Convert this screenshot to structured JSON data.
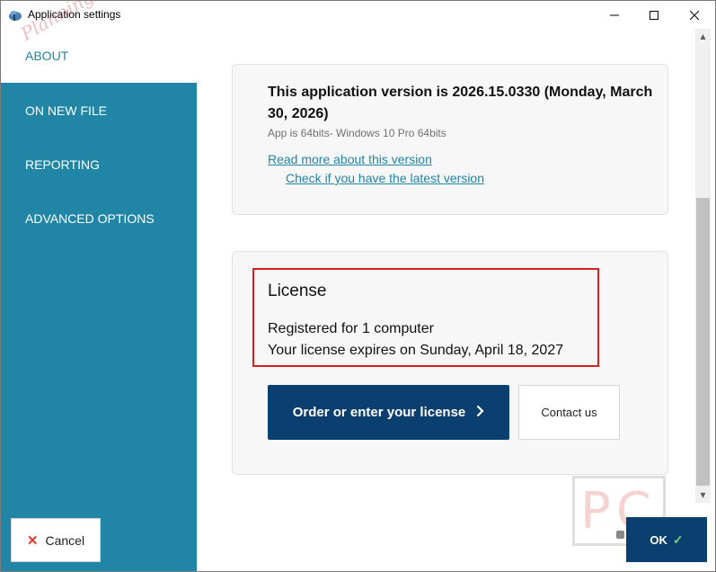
{
  "window": {
    "title": "Application settings",
    "minimize_icon": "minimize-icon",
    "maximize_icon": "maximize-icon",
    "close_icon": "close-icon"
  },
  "sidebar": {
    "items": [
      {
        "label": "ABOUT",
        "active": true
      },
      {
        "label": "ON NEW FILE",
        "active": false
      },
      {
        "label": "REPORTING",
        "active": false
      },
      {
        "label": "ADVANCED OPTIONS",
        "active": false
      }
    ],
    "cancel_label": "Cancel"
  },
  "about": {
    "version_title": "This application version is 2026.15.0330 (Monday, March 30, 2026)",
    "version_subtitle": "App is 64bits- Windows 10 Pro 64bits",
    "read_more_link": "Read more about this version",
    "check_latest_link": "Check if you have the latest version"
  },
  "license": {
    "title": "License",
    "registered": "Registered for 1 computer",
    "expires": "Your license expires on Sunday, April 18, 2027",
    "order_button": "Order or enter your license",
    "contact_button": "Contact us"
  },
  "footer": {
    "ok_label": "OK"
  },
  "watermark": {
    "side_text": "Planning PC",
    "logo_text": "PC"
  },
  "colors": {
    "sidebar": "#2185a5",
    "primary_button": "#0a3f70",
    "highlight_border": "#d32020",
    "link": "#2185a5"
  }
}
